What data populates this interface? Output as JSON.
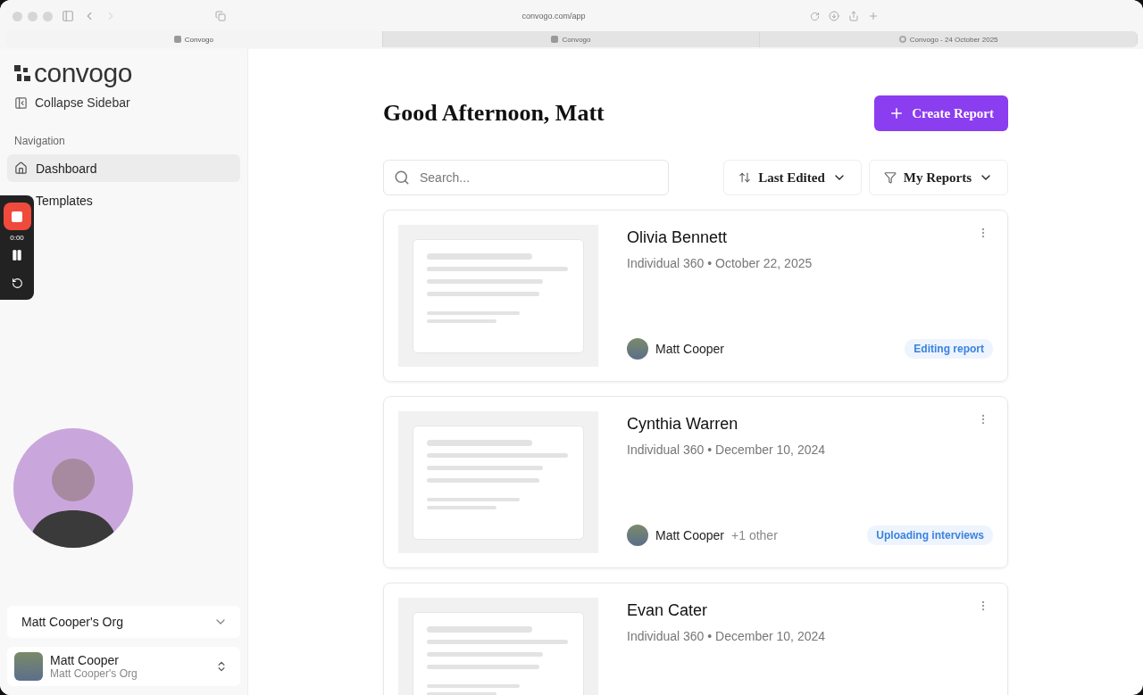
{
  "browser": {
    "url": "convogo.com/app",
    "tabs": [
      {
        "label": "Convogo",
        "selected": true,
        "kind": "app"
      },
      {
        "label": "Convogo",
        "selected": false,
        "kind": "app"
      },
      {
        "label": "Convogo - 24 October 2025",
        "selected": false,
        "kind": "loading"
      }
    ]
  },
  "sidebar": {
    "logo": "convogo",
    "collapse": "Collapse Sidebar",
    "section": "Navigation",
    "items": [
      {
        "label": "Dashboard",
        "selected": true,
        "kind": "home"
      },
      {
        "label": "Templates",
        "selected": false,
        "kind": "covered"
      }
    ],
    "org": "Matt Cooper's Org",
    "user": {
      "name": "Matt Cooper",
      "org": "Matt Cooper's Org"
    }
  },
  "recorder": {
    "time": "0:00"
  },
  "main": {
    "greeting": "Good Afternoon, Matt",
    "create": "Create Report",
    "search": {
      "placeholder": "Search..."
    },
    "sort": "Last Edited",
    "filter": "My Reports",
    "reports": [
      {
        "name": "Olivia Bennett",
        "meta": "Individual 360 • October 22, 2025",
        "owner": "Matt Cooper",
        "status": "Editing report"
      },
      {
        "name": "Cynthia Warren",
        "meta": "Individual 360 • December 10, 2024",
        "owner": "Matt Cooper",
        "extra": "+1 other",
        "status": "Uploading interviews"
      },
      {
        "name": "Evan Cater",
        "meta": "Individual 360 • December 10, 2024"
      }
    ]
  }
}
